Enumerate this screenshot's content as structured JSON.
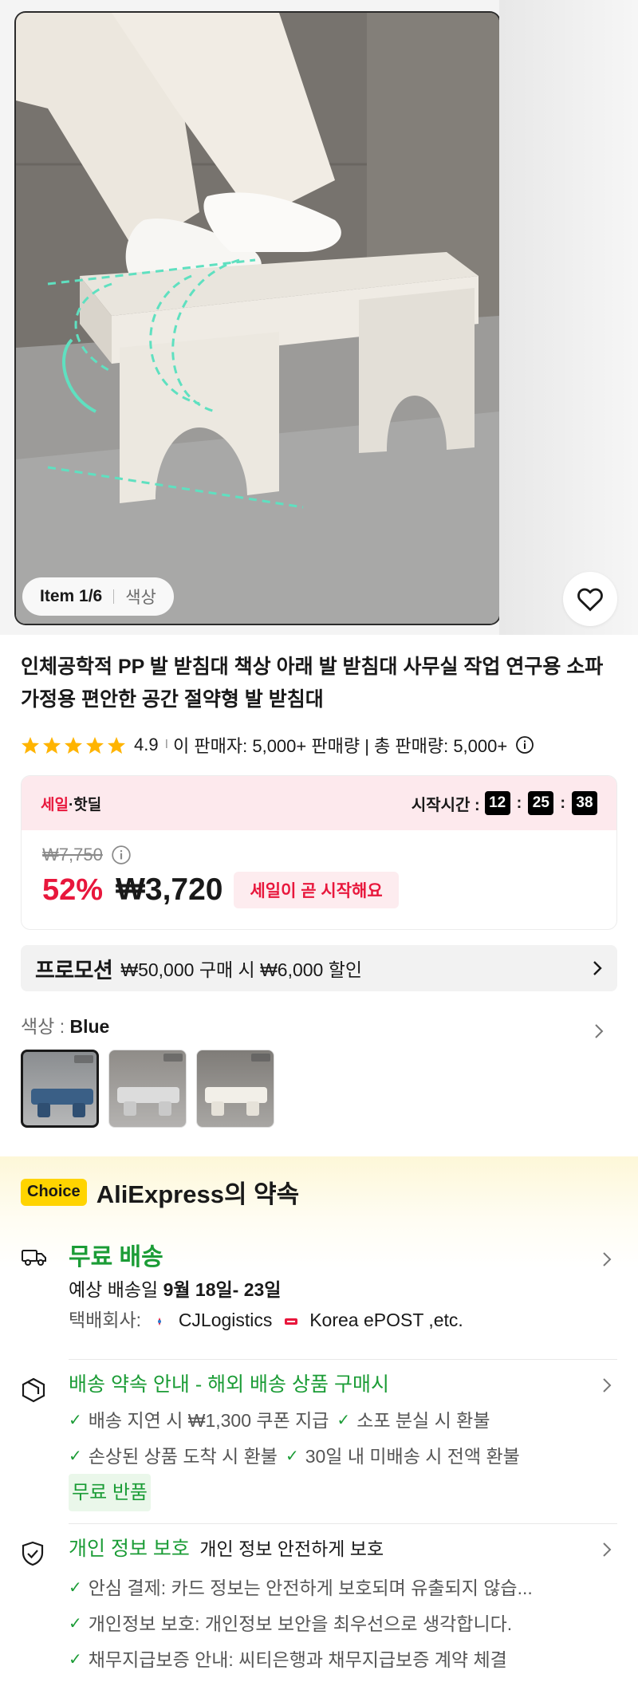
{
  "hero": {
    "badge_item": "Item 1/6",
    "badge_color": "색상"
  },
  "product": {
    "title": "인체공학적 PP 발 받침대 책상 아래 발 받침대 사무실 작업 연구용 소파 가정용 편안한 공간 절약형 발 받침대",
    "rating_score": "4.9",
    "rating_pipe": "I",
    "sales_text": "이 판매자: 5,000+ 판매량 | 총 판매량: 5,000+",
    "stars": 5
  },
  "sale": {
    "tag_red": "세일",
    "tag_rest": "·핫딜",
    "timer_label": "시작시간 :",
    "timer_h": "12",
    "timer_m": "25",
    "timer_s": "38",
    "timer_colon": ":",
    "original_price": "₩7,750",
    "discount": "52%",
    "price": "₩3,720",
    "soon_label": "세일이 곧 시작해요"
  },
  "promo": {
    "title": "프로모션",
    "text": "₩50,000 구매 시 ₩6,000 할인"
  },
  "color": {
    "label": "색상 : ",
    "value": "Blue",
    "swatches": [
      "#3a5f86",
      "#cfcfcf",
      "#f2efe8"
    ]
  },
  "choice": {
    "badge": "Choice",
    "title": "AliExpress의 약속",
    "shipping": {
      "title": "무료 배송",
      "eta_prefix": "예상 배송일 ",
      "eta_dates": "9월 18일- 23일",
      "carrier_label": "택배회사:",
      "carrier1": "CJLogistics",
      "carrier2": "Korea ePOST ,etc."
    },
    "delivery": {
      "title": "배송 약속 안내 - 해외 배송 상품 구매시",
      "check1": "배송 지연 시 ₩1,300 쿠폰 지급",
      "check2": "소포 분실 시 환불",
      "check3": "손상된 상품 도착 시 환불",
      "check4": "30일 내 미배송 시 전액 환불",
      "free_return": "무료 반품"
    },
    "privacy": {
      "title": "개인 정보 보호",
      "subtitle": "개인 정보 안전하게 보호",
      "check1": "안심 결제: 카드 정보는 안전하게 보호되며 유출되지 않습...",
      "check2": "개인정보 보호: 개인정보 보안을 최우선으로 생각합니다.",
      "check3": "채무지급보증 안내: 씨티은행과 채무지급보증 계약 체결"
    }
  },
  "icons": {
    "wishlist": "heart-icon",
    "info": "info-icon",
    "chevron": "chevron-right-icon",
    "truck": "truck-icon",
    "box": "package-icon",
    "shield": "shield-icon",
    "check": "check-icon"
  },
  "colors": {
    "accent_red": "#e8173c",
    "accent_green": "#1b9c36",
    "star": "#ffb400",
    "choice_yellow": "#ffd400"
  }
}
